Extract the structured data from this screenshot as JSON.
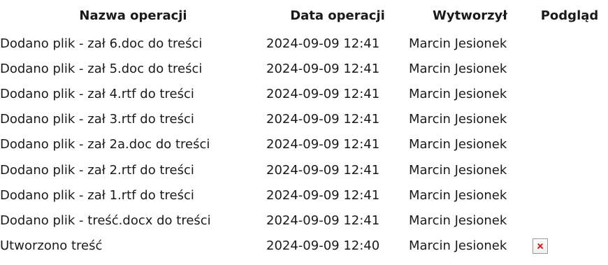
{
  "table": {
    "headers": {
      "name": "Nazwa operacji",
      "date": "Data operacji",
      "user": "Wytworzył",
      "preview": "Podgląd"
    },
    "rows": [
      {
        "name": "Dodano plik - zał 6.doc do treści",
        "date": "2024-09-09 12:41",
        "user": "Marcin Jesionek"
      },
      {
        "name": "Dodano plik - zał 5.doc do treści",
        "date": "2024-09-09 12:41",
        "user": "Marcin Jesionek"
      },
      {
        "name": "Dodano plik - zał 4.rtf do treści",
        "date": "2024-09-09 12:41",
        "user": "Marcin Jesionek"
      },
      {
        "name": "Dodano plik - zał 3.rtf do treści",
        "date": "2024-09-09 12:41",
        "user": "Marcin Jesionek"
      },
      {
        "name": "Dodano plik - zał 2a.doc do treści",
        "date": "2024-09-09 12:41",
        "user": "Marcin Jesionek"
      },
      {
        "name": "Dodano plik - zał 2.rtf do treści",
        "date": "2024-09-09 12:41",
        "user": "Marcin Jesionek"
      },
      {
        "name": "Dodano plik - zał 1.rtf do treści",
        "date": "2024-09-09 12:41",
        "user": "Marcin Jesionek"
      },
      {
        "name": "Dodano plik - treść.docx do treści",
        "date": "2024-09-09 12:41",
        "user": "Marcin Jesionek"
      },
      {
        "name": "Utworzono treść",
        "date": "2024-09-09 12:40",
        "user": "Marcin Jesionek",
        "preview_icon": "broken-image-icon"
      }
    ]
  }
}
